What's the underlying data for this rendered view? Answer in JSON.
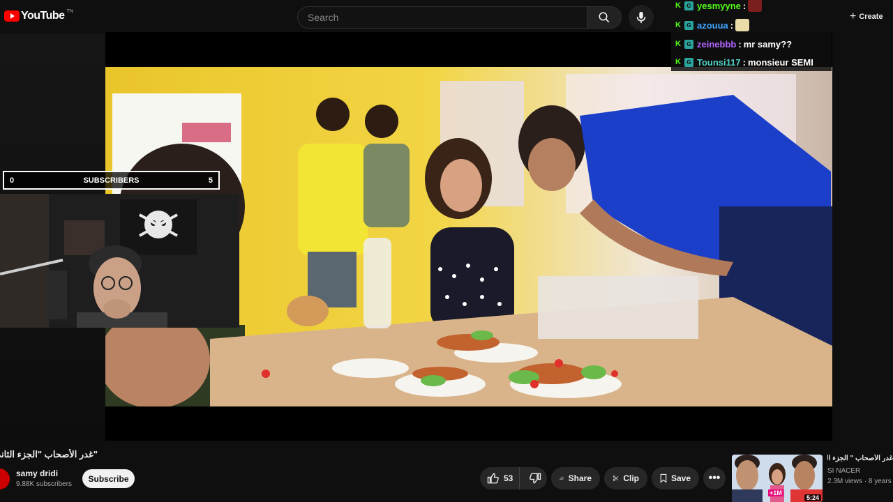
{
  "app": {
    "logo_text": "YouTube",
    "logo_trademark": "TN",
    "brand_color": "#ff0000"
  },
  "search": {
    "placeholder": "Search",
    "icon": "search-icon",
    "mic_icon": "mic-icon"
  },
  "header": {
    "create_label": "Create",
    "create_icon": "plus-icon"
  },
  "chat": {
    "messages": [
      {
        "user": "yesmyyne",
        "user_color": "#53fc18",
        "separator": ":",
        "text": ""
      },
      {
        "user": "azouua",
        "user_color": "#3ea6ff",
        "separator": ":",
        "text": ""
      },
      {
        "user": "zeinebbb",
        "user_color": "#b266ff",
        "separator": ":",
        "text": "mr samy??"
      },
      {
        "user": "Tounsi117",
        "user_color": "#4fd1c5",
        "separator": ":",
        "text": "monsieur SEMI"
      }
    ]
  },
  "overlay": {
    "sub_left": "0",
    "sub_label": "SUBSCRIBERS",
    "sub_right": "5"
  },
  "video": {
    "title": "\"غدر الأصحاب \"الجزء الثاني",
    "channel_name": "samy dridi",
    "channel_subs": "9.88K subscribers",
    "subscribe_label": "Subscribe",
    "like_count": "53",
    "share_label": "Share",
    "clip_label": "Clip",
    "save_label": "Save"
  },
  "recommended": {
    "title": "غدر الأصحاب \" الجزء الثاني\"",
    "channel": "SI NACER",
    "meta": "2.3M views · 8 years ago",
    "duration": "5:24",
    "badge": "+1M"
  }
}
